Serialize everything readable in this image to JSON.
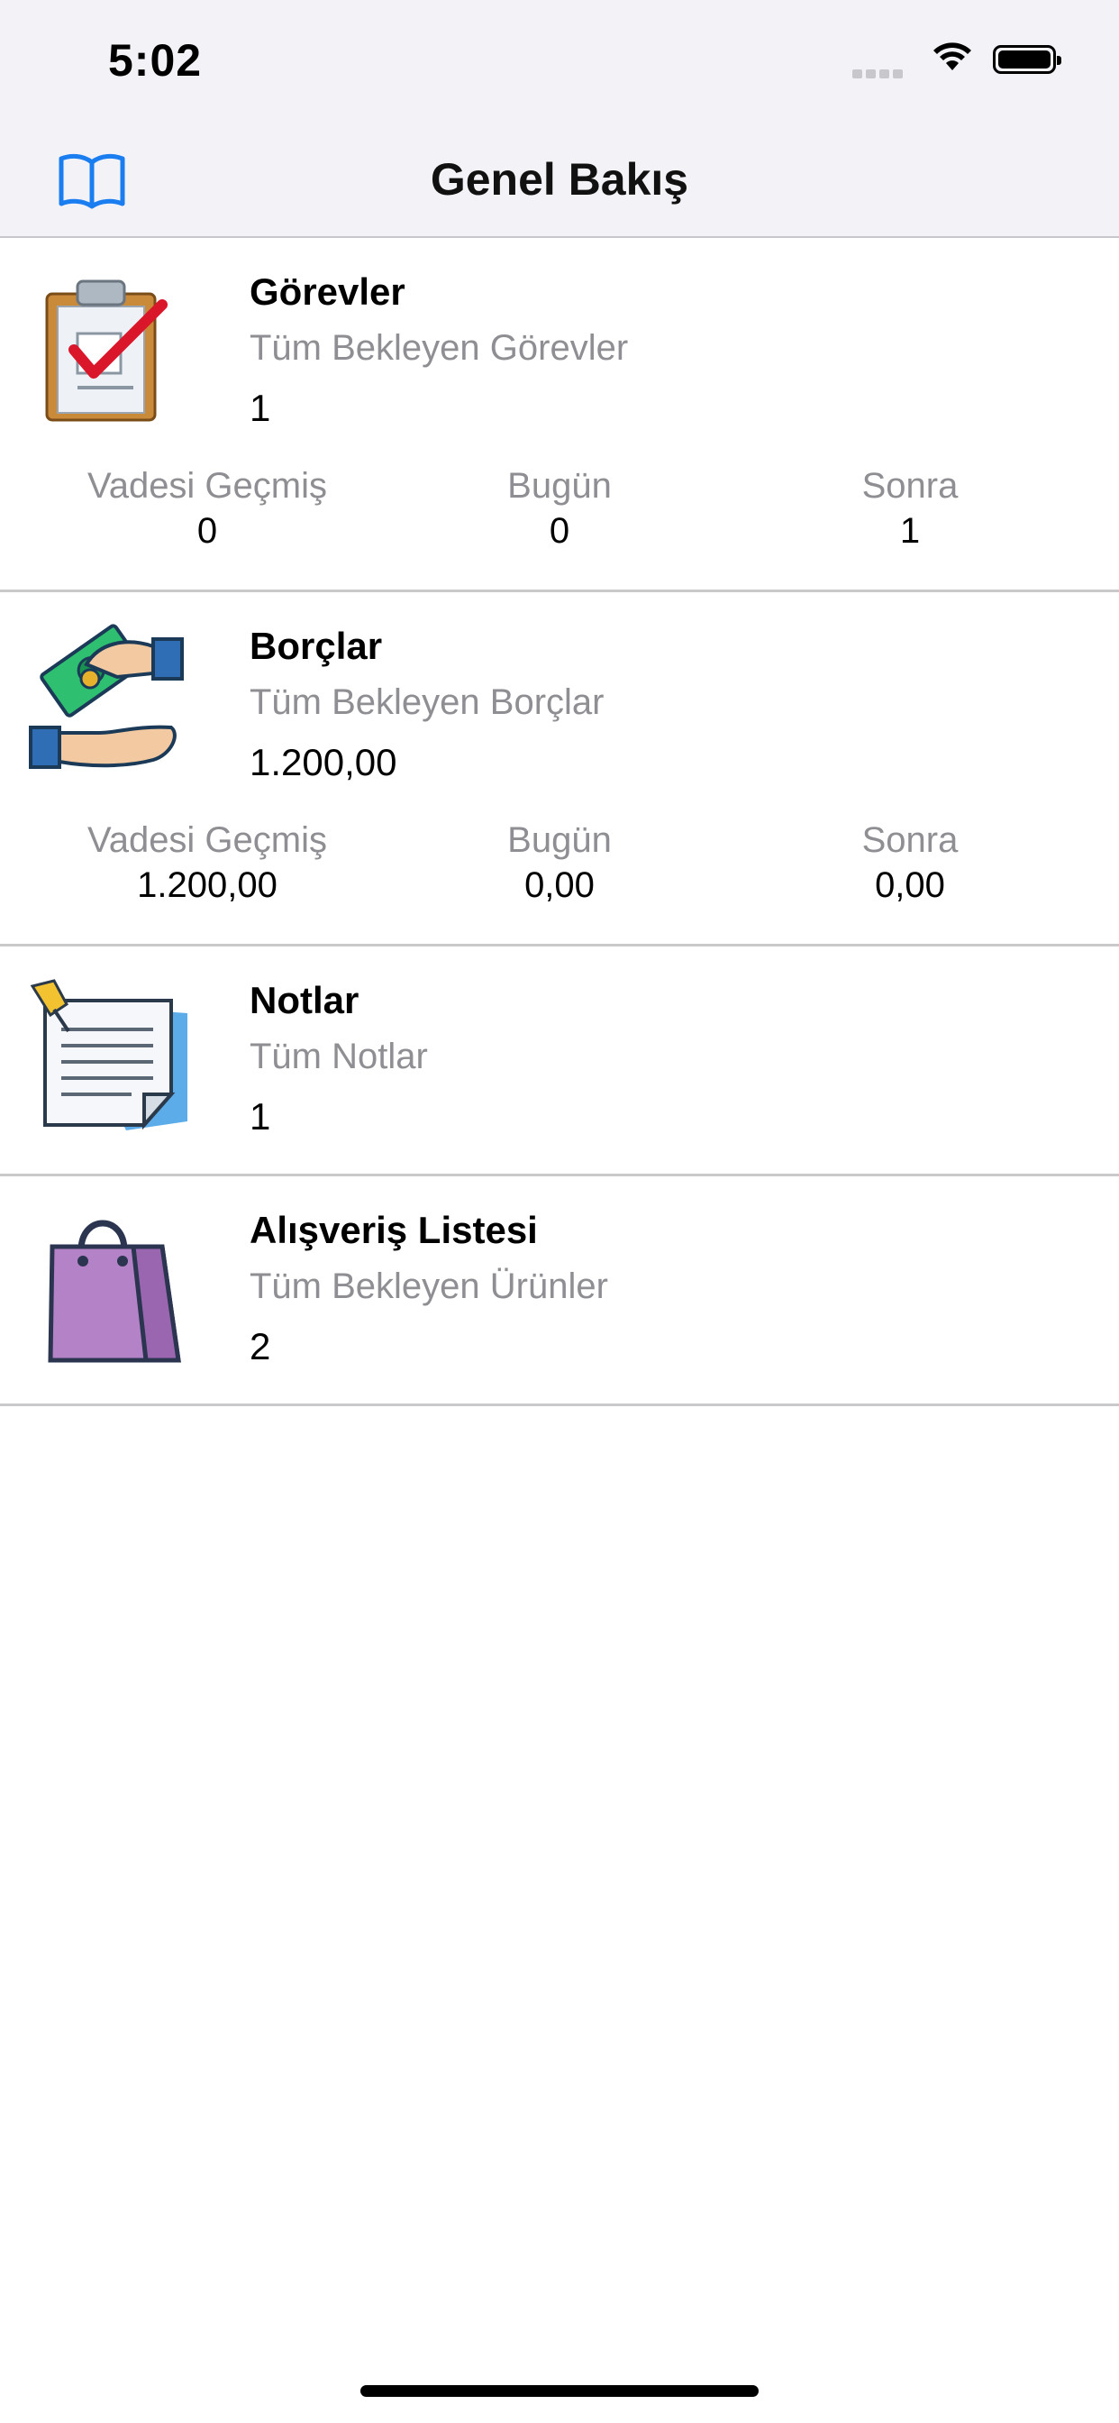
{
  "status_bar": {
    "time": "5:02"
  },
  "nav": {
    "title": "Genel Bakış",
    "left_icon": "book-icon"
  },
  "sections": {
    "tasks": {
      "title": "Görevler",
      "subtitle": "Tüm Bekleyen Görevler",
      "count": "1",
      "icon": "clipboard-check-icon",
      "stats": [
        {
          "label": "Vadesi Geçmiş",
          "value": "0"
        },
        {
          "label": "Bugün",
          "value": "0"
        },
        {
          "label": "Sonra",
          "value": "1"
        }
      ]
    },
    "debts": {
      "title": "Borçlar",
      "subtitle": "Tüm Bekleyen Borçlar",
      "count": "1.200,00",
      "icon": "money-hands-icon",
      "stats": [
        {
          "label": "Vadesi Geçmiş",
          "value": "1.200,00"
        },
        {
          "label": "Bugün",
          "value": "0,00"
        },
        {
          "label": "Sonra",
          "value": "0,00"
        }
      ]
    },
    "notes": {
      "title": "Notlar",
      "subtitle": "Tüm Notlar",
      "count": "1",
      "icon": "note-pin-icon"
    },
    "shopping": {
      "title": "Alışveriş Listesi",
      "subtitle": "Tüm Bekleyen Ürünler",
      "count": "2",
      "icon": "shopping-bag-icon"
    }
  },
  "colors": {
    "accent": "#1a7ef0",
    "secondary_text": "#8e8e93",
    "bar_bg": "#f2f2f7"
  }
}
